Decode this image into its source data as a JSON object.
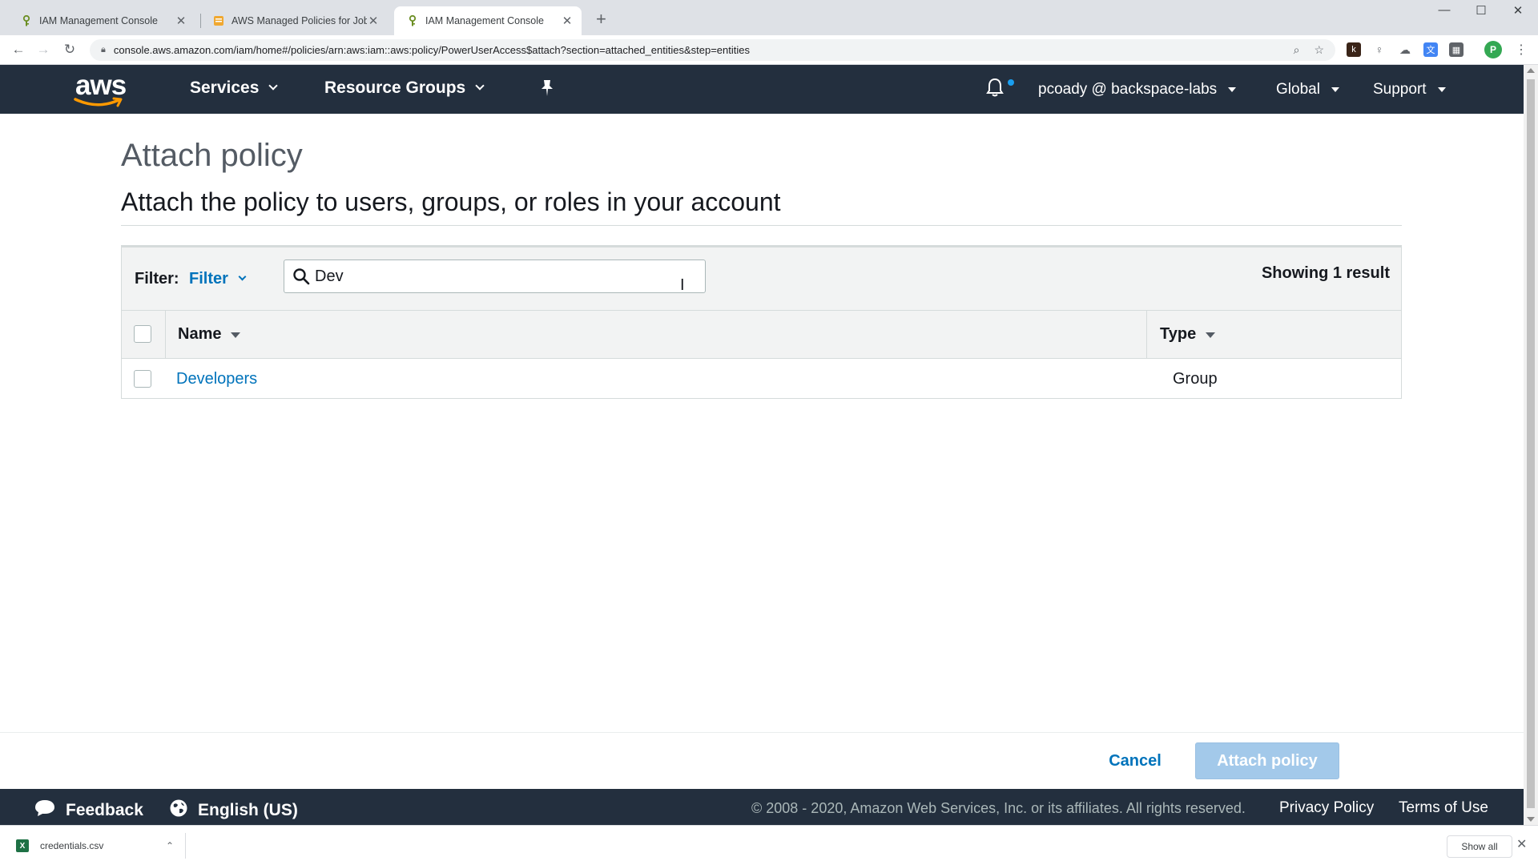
{
  "browser": {
    "tabs": [
      {
        "title": "IAM Management Console",
        "active": false
      },
      {
        "title": "AWS Managed Policies for Job F…",
        "active": false
      },
      {
        "title": "IAM Management Console",
        "active": true
      }
    ],
    "new_tab": "+",
    "url": "console.aws.amazon.com/iam/home#/policies/arn:aws:iam::aws:policy/PowerUserAccess$attach?section=attached_entities&step=entities",
    "profile_initial": "P"
  },
  "nav": {
    "logo": "aws",
    "services": "Services",
    "resource_groups": "Resource Groups",
    "account": "pcoady @ backspace-labs",
    "region": "Global",
    "support": "Support"
  },
  "page": {
    "title": "Attach policy",
    "subtitle": "Attach the policy to users, groups, or roles in your account"
  },
  "filter": {
    "label": "Filter:",
    "dropdown": "Filter",
    "search_value": "Dev",
    "result_count": "Showing 1 result"
  },
  "table": {
    "columns": [
      "Name",
      "Type"
    ],
    "rows": [
      {
        "name": "Developers",
        "type": "Group"
      }
    ]
  },
  "actions": {
    "cancel": "Cancel",
    "attach": "Attach policy"
  },
  "footer": {
    "feedback": "Feedback",
    "language": "English (US)",
    "copyright": "© 2008 - 2020, Amazon Web Services, Inc. or its affiliates. All rights reserved.",
    "privacy": "Privacy Policy",
    "terms": "Terms of Use"
  },
  "downloads": {
    "file": "credentials.csv",
    "show_all": "Show all"
  },
  "colors": {
    "nav_bg": "#232f3e",
    "link": "#0073bb",
    "primary_disabled": "#a3c9ea",
    "aws_smile": "#ff9900"
  }
}
